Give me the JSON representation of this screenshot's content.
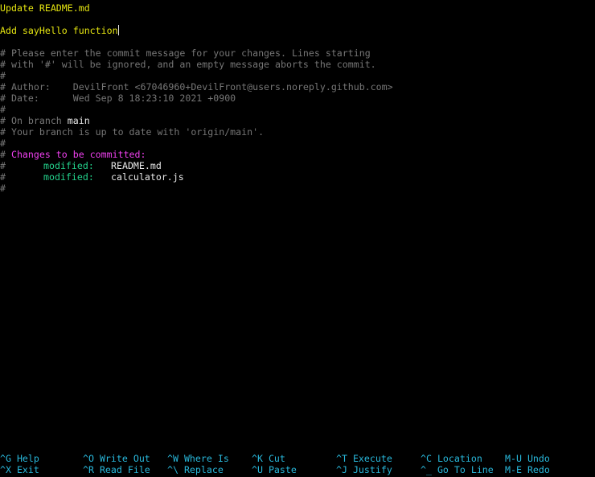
{
  "editor": {
    "subject_line": "Update README.md",
    "body_line": "Add sayHello function",
    "comments": [
      "# Please enter the commit message for your changes. Lines starting",
      "# with '#' will be ignored, and an empty message aborts the commit.",
      "#",
      "# Author:    DevilFront <67046960+DevilFront@users.noreply.github.com>",
      "# Date:      Wed Sep 8 18:23:10 2021 +0900",
      "#"
    ],
    "branch_prefix": "# On branch ",
    "branch_name": "main",
    "branch_status": "# Your branch is up to date with 'origin/main'.",
    "hash_line": "#",
    "changes_hash": "# ",
    "changes_header": "Changes to be committed:",
    "changes": [
      {
        "hash": "#",
        "status": "modified:",
        "file": "README.md"
      },
      {
        "hash": "#",
        "status": "modified:",
        "file": "calculator.js"
      }
    ],
    "trailing_hash": "#"
  },
  "shortcuts": [
    {
      "key": "^G",
      "label": "Help"
    },
    {
      "key": "^X",
      "label": "Exit"
    },
    {
      "key": "^O",
      "label": "Write Out"
    },
    {
      "key": "^R",
      "label": "Read File"
    },
    {
      "key": "^W",
      "label": "Where Is"
    },
    {
      "key": "^\\",
      "label": "Replace"
    },
    {
      "key": "^K",
      "label": "Cut"
    },
    {
      "key": "^U",
      "label": "Paste"
    },
    {
      "key": "^T",
      "label": "Execute"
    },
    {
      "key": "^J",
      "label": "Justify"
    },
    {
      "key": "^C",
      "label": "Location"
    },
    {
      "key": "^_",
      "label": "Go To Line"
    },
    {
      "key": "M-U",
      "label": "Undo"
    },
    {
      "key": "M-E",
      "label": "Redo"
    }
  ],
  "colors": {
    "background": "#000000",
    "text_yellow": "#e5e510",
    "comment_gray": "#767676",
    "header_magenta": "#f040f0",
    "status_green": "#23d18b",
    "shortcut_cyan": "#29b8db"
  }
}
